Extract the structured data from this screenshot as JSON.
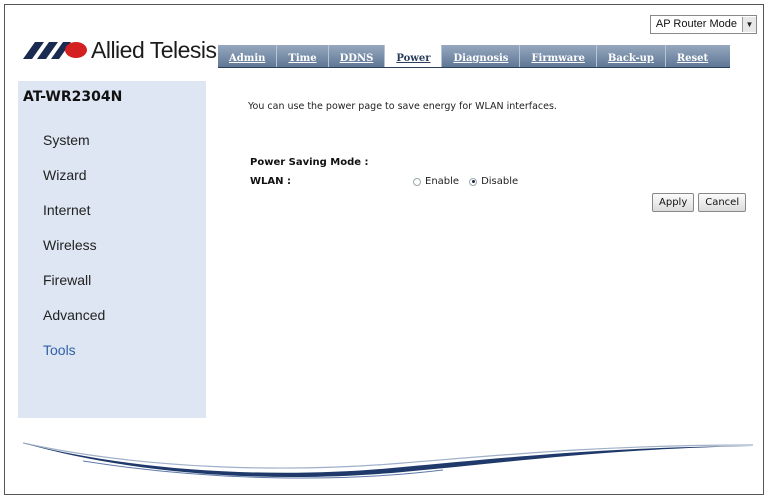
{
  "header": {
    "brand": "Allied Telesis",
    "mode_select": {
      "value": "AP Router Mode"
    }
  },
  "tabs": [
    {
      "label": "Admin"
    },
    {
      "label": "Time"
    },
    {
      "label": "DDNS"
    },
    {
      "label": "Power",
      "active": true
    },
    {
      "label": "Diagnosis"
    },
    {
      "label": "Firmware"
    },
    {
      "label": "Back-up"
    },
    {
      "label": "Reset"
    }
  ],
  "sidebar": {
    "model": "AT-WR2304N",
    "items": [
      {
        "label": "System"
      },
      {
        "label": "Wizard"
      },
      {
        "label": "Internet"
      },
      {
        "label": "Wireless"
      },
      {
        "label": "Firewall"
      },
      {
        "label": "Advanced"
      },
      {
        "label": "Tools",
        "active": true
      }
    ]
  },
  "main": {
    "intro": "You can use the power page to save energy for WLAN interfaces.",
    "section_title": "Power Saving Mode :",
    "wlan_label": "WLAN :",
    "options": {
      "enable": "Enable",
      "disable": "Disable",
      "selected": "Disable"
    },
    "buttons": {
      "apply": "Apply",
      "cancel": "Cancel"
    }
  },
  "colors": {
    "tab_bar": "#5f7795",
    "sidebar_bg": "#dde6f2",
    "active_nav": "#3060a8",
    "logo_red": "#d42020",
    "logo_dark": "#1a2a50"
  }
}
